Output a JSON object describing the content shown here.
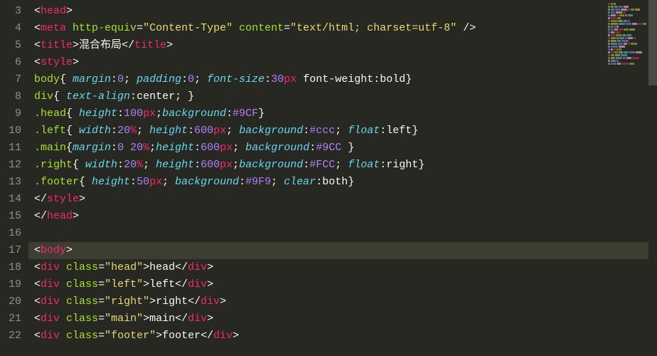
{
  "startLine": 3,
  "highlightLine": 17,
  "lines": [
    [
      [
        "punc",
        "<"
      ],
      [
        "tag",
        "head"
      ],
      [
        "punc",
        ">"
      ]
    ],
    [
      [
        "punc",
        "<"
      ],
      [
        "tag",
        "meta"
      ],
      [
        "text",
        " "
      ],
      [
        "attr",
        "http-equiv"
      ],
      [
        "punc",
        "="
      ],
      [
        "str",
        "\"Content-Type\""
      ],
      [
        "text",
        " "
      ],
      [
        "attr",
        "content"
      ],
      [
        "punc",
        "="
      ],
      [
        "str",
        "\"text/html; charset=utf-8\""
      ],
      [
        "text",
        " "
      ],
      [
        "punc",
        "/>"
      ]
    ],
    [
      [
        "punc",
        "<"
      ],
      [
        "tag",
        "title"
      ],
      [
        "punc",
        ">"
      ],
      [
        "text",
        "混合布局"
      ],
      [
        "punc",
        "</"
      ],
      [
        "tag",
        "title"
      ],
      [
        "punc",
        ">"
      ]
    ],
    [
      [
        "punc",
        "<"
      ],
      [
        "tag",
        "style"
      ],
      [
        "punc",
        ">"
      ]
    ],
    [
      [
        "sel",
        "body"
      ],
      [
        "punc",
        "{ "
      ],
      [
        "prop",
        "margin"
      ],
      [
        "punc",
        ":"
      ],
      [
        "num",
        "0"
      ],
      [
        "punc",
        "; "
      ],
      [
        "prop",
        "padding"
      ],
      [
        "punc",
        ":"
      ],
      [
        "num",
        "0"
      ],
      [
        "punc",
        "; "
      ],
      [
        "prop",
        "font-size"
      ],
      [
        "punc",
        ":"
      ],
      [
        "num",
        "30"
      ],
      [
        "unit",
        "px"
      ],
      [
        "text",
        " font-weight:bold"
      ],
      [
        "punc",
        "}"
      ]
    ],
    [
      [
        "sel",
        "div"
      ],
      [
        "punc",
        "{ "
      ],
      [
        "prop",
        "text-align"
      ],
      [
        "punc",
        ":"
      ],
      [
        "val",
        "center"
      ],
      [
        "punc",
        "; }"
      ]
    ],
    [
      [
        "sel",
        ".head"
      ],
      [
        "punc",
        "{ "
      ],
      [
        "prop",
        "height"
      ],
      [
        "punc",
        ":"
      ],
      [
        "num",
        "100"
      ],
      [
        "unit",
        "px"
      ],
      [
        "punc",
        ";"
      ],
      [
        "prop",
        "background"
      ],
      [
        "punc",
        ":"
      ],
      [
        "num",
        "#9CF"
      ],
      [
        "punc",
        "}"
      ]
    ],
    [
      [
        "sel",
        ".left"
      ],
      [
        "punc",
        "{ "
      ],
      [
        "prop",
        "width"
      ],
      [
        "punc",
        ":"
      ],
      [
        "num",
        "20"
      ],
      [
        "unit",
        "%"
      ],
      [
        "punc",
        "; "
      ],
      [
        "prop",
        "height"
      ],
      [
        "punc",
        ":"
      ],
      [
        "num",
        "600"
      ],
      [
        "unit",
        "px"
      ],
      [
        "punc",
        "; "
      ],
      [
        "prop",
        "background"
      ],
      [
        "punc",
        ":"
      ],
      [
        "num",
        "#ccc"
      ],
      [
        "punc",
        "; "
      ],
      [
        "prop",
        "float"
      ],
      [
        "punc",
        ":"
      ],
      [
        "val",
        "left"
      ],
      [
        "punc",
        "}"
      ]
    ],
    [
      [
        "sel",
        ".main"
      ],
      [
        "punc",
        "{"
      ],
      [
        "prop",
        "margin"
      ],
      [
        "punc",
        ":"
      ],
      [
        "num",
        "0"
      ],
      [
        "text",
        " "
      ],
      [
        "num",
        "20"
      ],
      [
        "unit",
        "%"
      ],
      [
        "punc",
        ";"
      ],
      [
        "prop",
        "height"
      ],
      [
        "punc",
        ":"
      ],
      [
        "num",
        "600"
      ],
      [
        "unit",
        "px"
      ],
      [
        "punc",
        "; "
      ],
      [
        "prop",
        "background"
      ],
      [
        "punc",
        ":"
      ],
      [
        "num",
        "#9CC"
      ],
      [
        "punc",
        " }"
      ]
    ],
    [
      [
        "sel",
        ".right"
      ],
      [
        "punc",
        "{ "
      ],
      [
        "prop",
        "width"
      ],
      [
        "punc",
        ":"
      ],
      [
        "num",
        "20"
      ],
      [
        "unit",
        "%"
      ],
      [
        "punc",
        "; "
      ],
      [
        "prop",
        "height"
      ],
      [
        "punc",
        ":"
      ],
      [
        "num",
        "600"
      ],
      [
        "unit",
        "px"
      ],
      [
        "punc",
        ";"
      ],
      [
        "prop",
        "background"
      ],
      [
        "punc",
        ":"
      ],
      [
        "num",
        "#FCC"
      ],
      [
        "punc",
        "; "
      ],
      [
        "prop",
        "float"
      ],
      [
        "punc",
        ":"
      ],
      [
        "val",
        "right"
      ],
      [
        "punc",
        "}"
      ]
    ],
    [
      [
        "sel",
        ".footer"
      ],
      [
        "punc",
        "{ "
      ],
      [
        "prop",
        "height"
      ],
      [
        "punc",
        ":"
      ],
      [
        "num",
        "50"
      ],
      [
        "unit",
        "px"
      ],
      [
        "punc",
        "; "
      ],
      [
        "prop",
        "background"
      ],
      [
        "punc",
        ":"
      ],
      [
        "num",
        "#9F9"
      ],
      [
        "punc",
        "; "
      ],
      [
        "prop",
        "clear"
      ],
      [
        "punc",
        ":"
      ],
      [
        "val",
        "both"
      ],
      [
        "punc",
        "}"
      ]
    ],
    [
      [
        "punc",
        "</"
      ],
      [
        "tag",
        "style"
      ],
      [
        "punc",
        ">"
      ]
    ],
    [
      [
        "punc",
        "</"
      ],
      [
        "tag",
        "head"
      ],
      [
        "punc",
        ">"
      ]
    ],
    [],
    [
      [
        "punc",
        "<"
      ],
      [
        "tag",
        "body"
      ],
      [
        "punc",
        ">"
      ]
    ],
    [
      [
        "punc",
        "<"
      ],
      [
        "tag",
        "div"
      ],
      [
        "text",
        " "
      ],
      [
        "attr",
        "class"
      ],
      [
        "punc",
        "="
      ],
      [
        "str",
        "\"head\""
      ],
      [
        "punc",
        ">"
      ],
      [
        "text",
        "head"
      ],
      [
        "punc",
        "</"
      ],
      [
        "tag",
        "div"
      ],
      [
        "punc",
        ">"
      ]
    ],
    [
      [
        "punc",
        "<"
      ],
      [
        "tag",
        "div"
      ],
      [
        "text",
        " "
      ],
      [
        "attr",
        "class"
      ],
      [
        "punc",
        "="
      ],
      [
        "str",
        "\"left\""
      ],
      [
        "punc",
        ">"
      ],
      [
        "text",
        "left"
      ],
      [
        "punc",
        "</"
      ],
      [
        "tag",
        "div"
      ],
      [
        "punc",
        ">"
      ]
    ],
    [
      [
        "punc",
        "<"
      ],
      [
        "tag",
        "div"
      ],
      [
        "text",
        " "
      ],
      [
        "attr",
        "class"
      ],
      [
        "punc",
        "="
      ],
      [
        "str",
        "\"right\""
      ],
      [
        "punc",
        ">"
      ],
      [
        "text",
        "right"
      ],
      [
        "punc",
        "</"
      ],
      [
        "tag",
        "div"
      ],
      [
        "punc",
        ">"
      ]
    ],
    [
      [
        "punc",
        "<"
      ],
      [
        "tag",
        "div"
      ],
      [
        "text",
        " "
      ],
      [
        "attr",
        "class"
      ],
      [
        "punc",
        "="
      ],
      [
        "str",
        "\"main\""
      ],
      [
        "punc",
        ">"
      ],
      [
        "text",
        "main"
      ],
      [
        "punc",
        "</"
      ],
      [
        "tag",
        "div"
      ],
      [
        "punc",
        ">"
      ]
    ],
    [
      [
        "punc",
        "<"
      ],
      [
        "tag",
        "div"
      ],
      [
        "text",
        " "
      ],
      [
        "attr",
        "class"
      ],
      [
        "punc",
        "="
      ],
      [
        "str",
        "\"footer\""
      ],
      [
        "punc",
        ">"
      ],
      [
        "text",
        "footer"
      ],
      [
        "punc",
        "</"
      ],
      [
        "tag",
        "div"
      ],
      [
        "punc",
        ">"
      ]
    ]
  ],
  "minimapColors": [
    "#f92672",
    "#a6e22e",
    "#e6db74",
    "#66d9ef",
    "#ae81ff",
    "#f8f8f2"
  ]
}
